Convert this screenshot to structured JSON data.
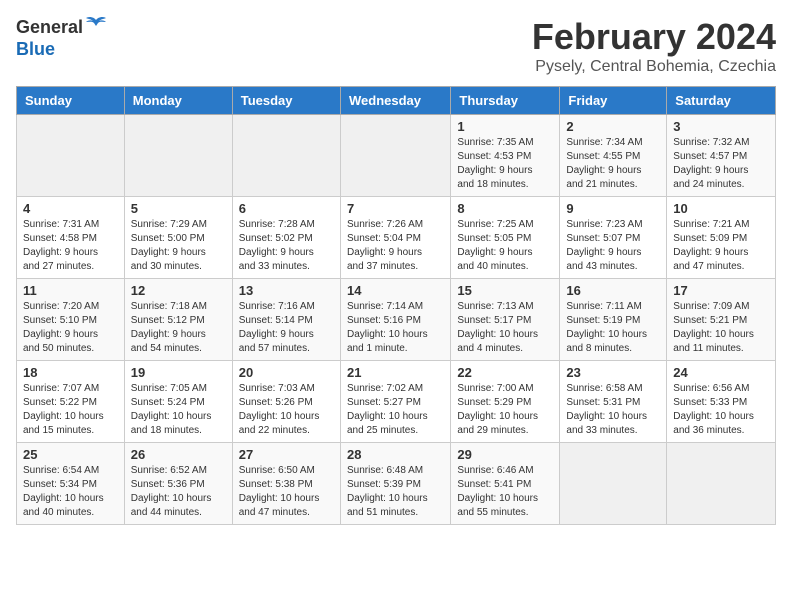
{
  "header": {
    "logo": {
      "general": "General",
      "blue": "Blue"
    },
    "title": "February 2024",
    "location": "Pysely, Central Bohemia, Czechia"
  },
  "calendar": {
    "days_of_week": [
      "Sunday",
      "Monday",
      "Tuesday",
      "Wednesday",
      "Thursday",
      "Friday",
      "Saturday"
    ],
    "weeks": [
      [
        {
          "day": "",
          "info": ""
        },
        {
          "day": "",
          "info": ""
        },
        {
          "day": "",
          "info": ""
        },
        {
          "day": "",
          "info": ""
        },
        {
          "day": "1",
          "info": "Sunrise: 7:35 AM\nSunset: 4:53 PM\nDaylight: 9 hours\nand 18 minutes."
        },
        {
          "day": "2",
          "info": "Sunrise: 7:34 AM\nSunset: 4:55 PM\nDaylight: 9 hours\nand 21 minutes."
        },
        {
          "day": "3",
          "info": "Sunrise: 7:32 AM\nSunset: 4:57 PM\nDaylight: 9 hours\nand 24 minutes."
        }
      ],
      [
        {
          "day": "4",
          "info": "Sunrise: 7:31 AM\nSunset: 4:58 PM\nDaylight: 9 hours\nand 27 minutes."
        },
        {
          "day": "5",
          "info": "Sunrise: 7:29 AM\nSunset: 5:00 PM\nDaylight: 9 hours\nand 30 minutes."
        },
        {
          "day": "6",
          "info": "Sunrise: 7:28 AM\nSunset: 5:02 PM\nDaylight: 9 hours\nand 33 minutes."
        },
        {
          "day": "7",
          "info": "Sunrise: 7:26 AM\nSunset: 5:04 PM\nDaylight: 9 hours\nand 37 minutes."
        },
        {
          "day": "8",
          "info": "Sunrise: 7:25 AM\nSunset: 5:05 PM\nDaylight: 9 hours\nand 40 minutes."
        },
        {
          "day": "9",
          "info": "Sunrise: 7:23 AM\nSunset: 5:07 PM\nDaylight: 9 hours\nand 43 minutes."
        },
        {
          "day": "10",
          "info": "Sunrise: 7:21 AM\nSunset: 5:09 PM\nDaylight: 9 hours\nand 47 minutes."
        }
      ],
      [
        {
          "day": "11",
          "info": "Sunrise: 7:20 AM\nSunset: 5:10 PM\nDaylight: 9 hours\nand 50 minutes."
        },
        {
          "day": "12",
          "info": "Sunrise: 7:18 AM\nSunset: 5:12 PM\nDaylight: 9 hours\nand 54 minutes."
        },
        {
          "day": "13",
          "info": "Sunrise: 7:16 AM\nSunset: 5:14 PM\nDaylight: 9 hours\nand 57 minutes."
        },
        {
          "day": "14",
          "info": "Sunrise: 7:14 AM\nSunset: 5:16 PM\nDaylight: 10 hours\nand 1 minute."
        },
        {
          "day": "15",
          "info": "Sunrise: 7:13 AM\nSunset: 5:17 PM\nDaylight: 10 hours\nand 4 minutes."
        },
        {
          "day": "16",
          "info": "Sunrise: 7:11 AM\nSunset: 5:19 PM\nDaylight: 10 hours\nand 8 minutes."
        },
        {
          "day": "17",
          "info": "Sunrise: 7:09 AM\nSunset: 5:21 PM\nDaylight: 10 hours\nand 11 minutes."
        }
      ],
      [
        {
          "day": "18",
          "info": "Sunrise: 7:07 AM\nSunset: 5:22 PM\nDaylight: 10 hours\nand 15 minutes."
        },
        {
          "day": "19",
          "info": "Sunrise: 7:05 AM\nSunset: 5:24 PM\nDaylight: 10 hours\nand 18 minutes."
        },
        {
          "day": "20",
          "info": "Sunrise: 7:03 AM\nSunset: 5:26 PM\nDaylight: 10 hours\nand 22 minutes."
        },
        {
          "day": "21",
          "info": "Sunrise: 7:02 AM\nSunset: 5:27 PM\nDaylight: 10 hours\nand 25 minutes."
        },
        {
          "day": "22",
          "info": "Sunrise: 7:00 AM\nSunset: 5:29 PM\nDaylight: 10 hours\nand 29 minutes."
        },
        {
          "day": "23",
          "info": "Sunrise: 6:58 AM\nSunset: 5:31 PM\nDaylight: 10 hours\nand 33 minutes."
        },
        {
          "day": "24",
          "info": "Sunrise: 6:56 AM\nSunset: 5:33 PM\nDaylight: 10 hours\nand 36 minutes."
        }
      ],
      [
        {
          "day": "25",
          "info": "Sunrise: 6:54 AM\nSunset: 5:34 PM\nDaylight: 10 hours\nand 40 minutes."
        },
        {
          "day": "26",
          "info": "Sunrise: 6:52 AM\nSunset: 5:36 PM\nDaylight: 10 hours\nand 44 minutes."
        },
        {
          "day": "27",
          "info": "Sunrise: 6:50 AM\nSunset: 5:38 PM\nDaylight: 10 hours\nand 47 minutes."
        },
        {
          "day": "28",
          "info": "Sunrise: 6:48 AM\nSunset: 5:39 PM\nDaylight: 10 hours\nand 51 minutes."
        },
        {
          "day": "29",
          "info": "Sunrise: 6:46 AM\nSunset: 5:41 PM\nDaylight: 10 hours\nand 55 minutes."
        },
        {
          "day": "",
          "info": ""
        },
        {
          "day": "",
          "info": ""
        }
      ]
    ]
  }
}
